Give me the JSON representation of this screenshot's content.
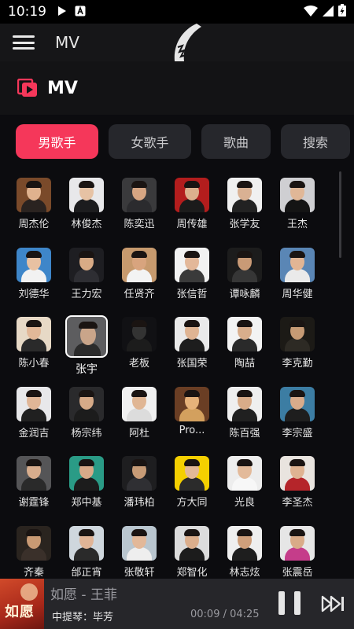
{
  "status_bar": {
    "time": "10:19"
  },
  "app_bar": {
    "title": "MV"
  },
  "section": {
    "title": "MV"
  },
  "tabs": [
    {
      "label": "男歌手",
      "active": true
    },
    {
      "label": "女歌手",
      "active": false
    },
    {
      "label": "歌曲",
      "active": false
    },
    {
      "label": "搜索",
      "active": false
    }
  ],
  "artists": [
    {
      "name": "周杰伦"
    },
    {
      "name": "林俊杰"
    },
    {
      "name": "陈奕迅"
    },
    {
      "name": "周传雄"
    },
    {
      "name": "张学友"
    },
    {
      "name": "王杰"
    },
    {
      "name": "刘德华"
    },
    {
      "name": "王力宏"
    },
    {
      "name": "任贤齐"
    },
    {
      "name": "张信哲"
    },
    {
      "name": "谭咏麟"
    },
    {
      "name": "周华健"
    },
    {
      "name": "陈小春"
    },
    {
      "name": "张宇",
      "selected": true
    },
    {
      "name": "老板"
    },
    {
      "name": "张国荣"
    },
    {
      "name": "陶喆"
    },
    {
      "name": "李克勤"
    },
    {
      "name": "金润吉"
    },
    {
      "name": "杨宗纬"
    },
    {
      "name": "阿杜"
    },
    {
      "name": "Pro..."
    },
    {
      "name": "陈百强"
    },
    {
      "name": "李宗盛"
    },
    {
      "name": "谢霆锋"
    },
    {
      "name": "郑中基"
    },
    {
      "name": "潘玮柏"
    },
    {
      "name": "方大同"
    },
    {
      "name": "光良"
    },
    {
      "name": "李圣杰"
    },
    {
      "name": "齐秦"
    },
    {
      "name": "邰正宵"
    },
    {
      "name": "张敬轩"
    },
    {
      "name": "郑智化"
    },
    {
      "name": "林志炫"
    },
    {
      "name": "张震岳"
    }
  ],
  "player": {
    "cover_text": "如愿",
    "title": "如愿 - 王菲",
    "subtitle": "中提琴：毕芳",
    "time": "00:09 / 04:25",
    "state": "playing"
  },
  "colors": {
    "accent": "#f5375a",
    "background": "#0c0c0f",
    "tab_inactive": "#26272c",
    "player_bg": "#26262a"
  },
  "icons": [
    "play-notification-icon",
    "sim-a-icon",
    "wifi-icon",
    "signal-icon",
    "battery-charging-icon",
    "menu-icon",
    "mv-icon",
    "pause-icon",
    "skip-next-icon"
  ]
}
